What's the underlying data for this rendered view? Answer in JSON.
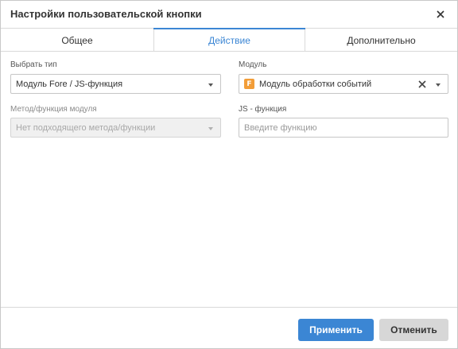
{
  "dialog": {
    "title": "Настройки пользовательской кнопки"
  },
  "tabs": [
    {
      "label": "Общее",
      "active": false
    },
    {
      "label": "Действие",
      "active": true
    },
    {
      "label": "Дополнительно",
      "active": false
    }
  ],
  "form": {
    "type_label": "Выбрать тип",
    "type_value": "Модуль Fore / JS-функция",
    "module_label": "Модуль",
    "module_icon_letter": "F",
    "module_value": "Модуль обработки событий",
    "method_label": "Метод/функция модуля",
    "method_value": "Нет подходящего метода/функции",
    "js_label": "JS - функция",
    "js_placeholder": "Введите функцию",
    "js_value": ""
  },
  "footer": {
    "apply_label": "Применить",
    "cancel_label": "Отменить"
  },
  "colors": {
    "accent": "#3b86d4",
    "module_icon": "#f29d38",
    "cancel_bg": "#d7d7d7"
  },
  "icons": {
    "close": "close-icon",
    "caret": "chevron-down-icon",
    "clear": "clear-icon",
    "module": "fore-module-icon"
  }
}
